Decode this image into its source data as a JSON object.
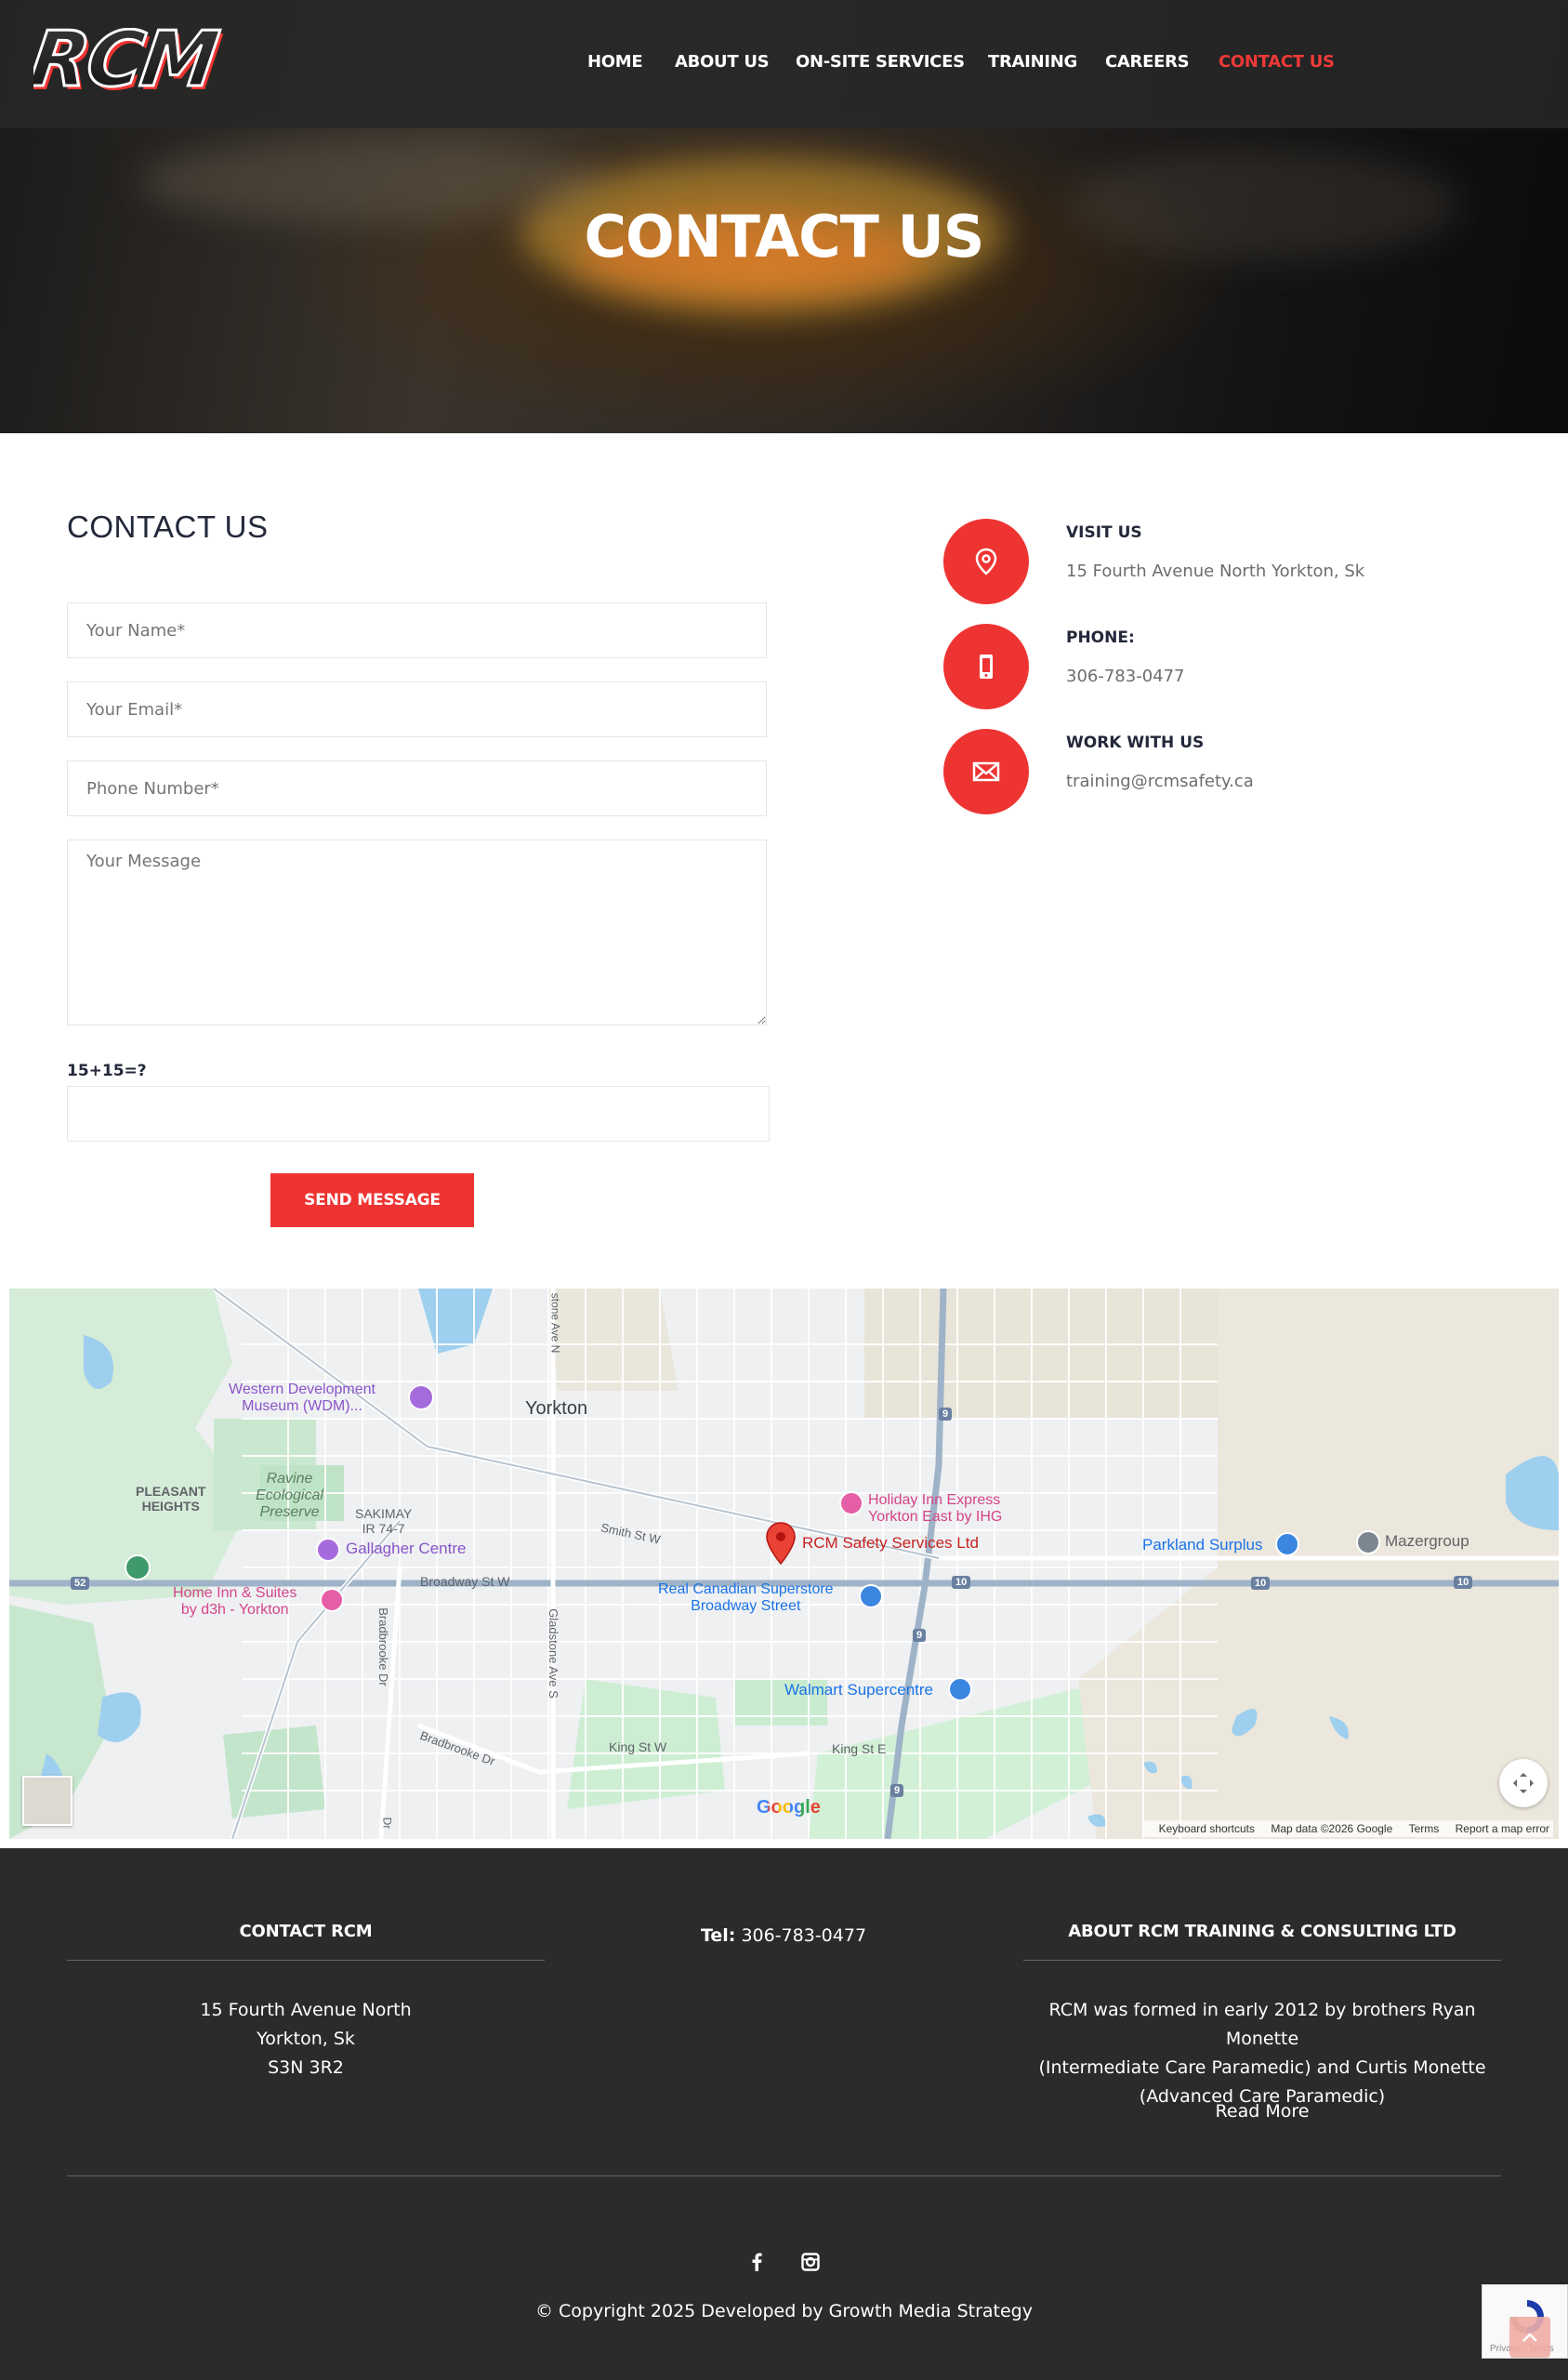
{
  "brand": {
    "logo_text": "RCM",
    "accent": "#ee3432"
  },
  "nav": {
    "items": [
      {
        "label": "HOME"
      },
      {
        "label": "ABOUT US"
      },
      {
        "label": "ON-SITE SERVICES"
      },
      {
        "label": "TRAINING"
      },
      {
        "label": "CAREERS"
      },
      {
        "label": "CONTACT US",
        "active": true
      }
    ]
  },
  "hero": {
    "title": "CONTACT US"
  },
  "form": {
    "heading": "CONTACT US",
    "name_placeholder": "Your Name*",
    "email_placeholder": "Your Email*",
    "phone_placeholder": "Phone Number*",
    "message_placeholder": "Your Message",
    "captcha_label": "15+15=?",
    "send_label": "SEND MESSAGE"
  },
  "info": {
    "visit_title": "VISIT US",
    "visit_text": "15 Fourth Avenue North Yorkton, Sk",
    "phone_title": "PHONE:",
    "phone_text": "306-783-0477",
    "work_title": "WORK WITH US",
    "work_text": "training@rcmsafety.ca",
    "icons": [
      "location-pin-icon",
      "mobile-phone-icon",
      "envelope-icon"
    ]
  },
  "map": {
    "labels": {
      "yorkton": "Yorkton",
      "wdm_1": "Western Development",
      "wdm_2": "Museum (WDM)...",
      "pleasant_1": "PLEASANT",
      "pleasant_2": "HEIGHTS",
      "ravine_1": "Ravine",
      "ravine_2": "Ecological",
      "ravine_3": "Preserve",
      "sakimay_1": "SAKIMAY",
      "sakimay_2": "IR 74-7",
      "gallagher": "Gallagher Centre",
      "home_inn_1": "Home Inn & Suites",
      "home_inn_2": "by d3h - Yorkton",
      "holiday_1": "Holiday Inn Express",
      "holiday_2": "Yorkton East by IHG",
      "rcm": "RCM Safety Services Ltd",
      "parkland": "Parkland Surplus",
      "mazergroup": "Mazergroup",
      "superstore_1": "Real Canadian Superstore",
      "superstore_2": "Broadway Street",
      "walmart": "Walmart Supercentre",
      "smith": "Smith St W",
      "broadway": "Broadway St W",
      "bradbrooke": "Bradbrooke Dr",
      "bradbrooke_vert": "Bradbrooke Dr",
      "gladstone": "Gladstone Ave S",
      "gladstone_n": "stone Ave N",
      "king_w": "King St W",
      "king_e": "King St E",
      "hwy_52": "52",
      "hwy_9": "9",
      "hwy_10": "10",
      "dr": "Dr"
    },
    "google": "Google",
    "footer": {
      "shortcuts": "Keyboard shortcuts",
      "data": "Map data ©2026 Google",
      "terms": "Terms",
      "report": "Report a map error"
    }
  },
  "footer": {
    "contact_heading": "CONTACT RCM",
    "address_line1": "15 Fourth Avenue North",
    "address_line2": "Yorkton, Sk",
    "address_line3": "S3N 3R2",
    "tel_label": "Tel:",
    "tel_value": "306-783-0477",
    "about_heading": "ABOUT RCM TRAINING & CONSULTING LTD",
    "about_line1": "RCM was formed in early 2012 by brothers Ryan Monette",
    "about_line2": "(Intermediate Care Paramedic) and Curtis Monette",
    "about_line3": "(Advanced Care Paramedic)",
    "read_more": "Read More",
    "copyright": "© Copyright 2025 Developed by Growth Media Strategy",
    "recaptcha": "Privacy - Terms"
  }
}
